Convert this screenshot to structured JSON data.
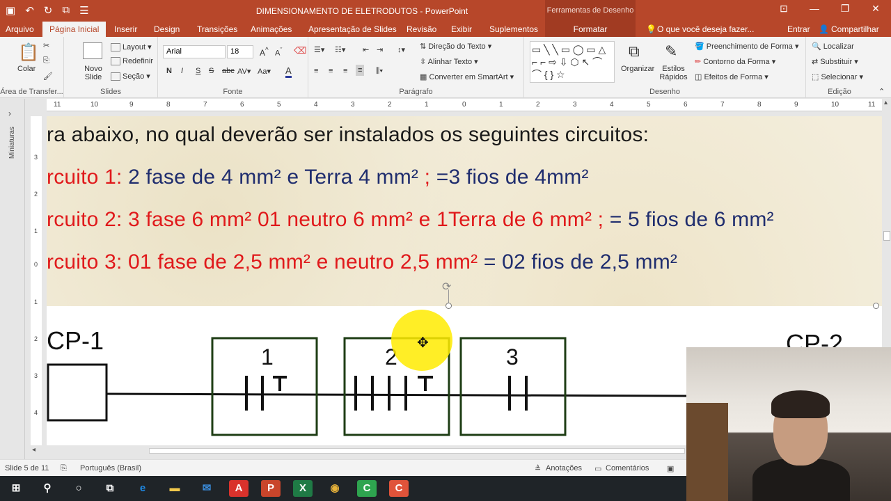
{
  "window": {
    "title": "DIMENSIONAMENTO DE ELETRODUTOS - PowerPoint",
    "contextual_group": "Ferramentas de Desenho"
  },
  "tabs": [
    "Arquivo",
    "Página Inicial",
    "Inserir",
    "Design",
    "Transições",
    "Animações",
    "Apresentação de Slides",
    "Revisão",
    "Exibir",
    "Suplementos",
    "Formatar"
  ],
  "tell_me": "O que você deseja fazer...",
  "account": {
    "signin": "Entrar",
    "share": "Compartilhar"
  },
  "ribbon": {
    "clipboard": {
      "label": "Área de Transfer...",
      "paste": "Colar"
    },
    "slides": {
      "label": "Slides",
      "new_slide": "Novo Slide",
      "layout": "Layout",
      "reset": "Redefinir",
      "section": "Seção"
    },
    "font": {
      "label": "Fonte",
      "font_name": "Arial",
      "font_size": "18"
    },
    "paragraph": {
      "label": "Parágrafo",
      "text_direction": "Direção do Texto",
      "align_text": "Alinhar Texto",
      "smartart": "Converter em SmartArt"
    },
    "drawing": {
      "label": "Desenho",
      "arrange": "Organizar",
      "quick_styles": "Estilos Rápidos",
      "fill": "Preenchimento de Forma",
      "outline": "Contorno da Forma",
      "effects": "Efeitos de Forma"
    },
    "editing": {
      "label": "Edição",
      "find": "Localizar",
      "replace": "Substituir",
      "select": "Selecionar"
    }
  },
  "side_panel": {
    "label": "Miniaturas"
  },
  "ruler": {
    "top": [
      "11",
      "10",
      "9",
      "8",
      "7",
      "6",
      "5",
      "4",
      "3",
      "2",
      "1",
      "0",
      "1",
      "2",
      "3",
      "4",
      "5",
      "6",
      "7",
      "8",
      "9",
      "10",
      "11"
    ],
    "left": [
      "3",
      "2",
      "1",
      "0",
      "1",
      "2",
      "3",
      "4"
    ]
  },
  "slide": {
    "line0": "ra abaixo, no qual deverão ser instalados os seguintes circuitos:",
    "c1_prefix": "rcuito 1: ",
    "c1_text": "2 fase de  4 mm² e Terra  4 mm² ",
    "c1_semicolon": ";",
    "c1_result": " =3 fios de 4mm²",
    "c2_text": "rcuito 2: 3 fase 6 mm² 01 neutro 6 mm² e 1Terra de  6 mm² ;",
    "c2_result": " = 5 fios de 6 mm²",
    "c3_text": "rcuito 3: 01 fase de  2,5 mm²  e neutro 2,5 mm²",
    "c3_result": " = 02 fios de 2,5 mm²",
    "diagram": {
      "left_panel": "CP-1",
      "right_panel": "CP-2",
      "box_labels": [
        "1",
        "2",
        "3"
      ]
    }
  },
  "status": {
    "slide_counter": "Slide 5 de 11",
    "language": "Português (Brasil)",
    "notes": "Anotações",
    "comments": "Comentários"
  },
  "colors": {
    "accent": "#b7472a",
    "red_text": "#e0191b",
    "navy_text": "#1f2d6e",
    "box_green": "#1e3d14"
  }
}
